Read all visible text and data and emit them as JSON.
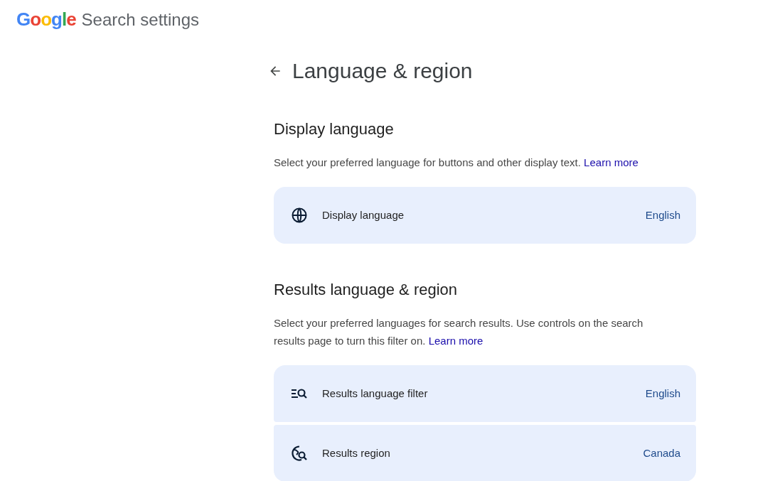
{
  "header": {
    "logo": "Google",
    "title": "Search settings"
  },
  "page": {
    "title": "Language & region"
  },
  "sections": [
    {
      "heading": "Display language",
      "description": "Select your preferred language for buttons and other display text.",
      "link": "Learn more",
      "items": [
        {
          "kind": "globe",
          "label": "Display language",
          "value": "English"
        }
      ]
    },
    {
      "heading": "Results language & region",
      "description": "Select your preferred languages for search results. Use controls on the search results page to turn this filter on.",
      "link": "Learn more",
      "items": [
        {
          "kind": "filter",
          "label": "Results language filter",
          "value": "English"
        },
        {
          "kind": "region",
          "label": "Results region",
          "value": "Canada"
        }
      ]
    }
  ]
}
